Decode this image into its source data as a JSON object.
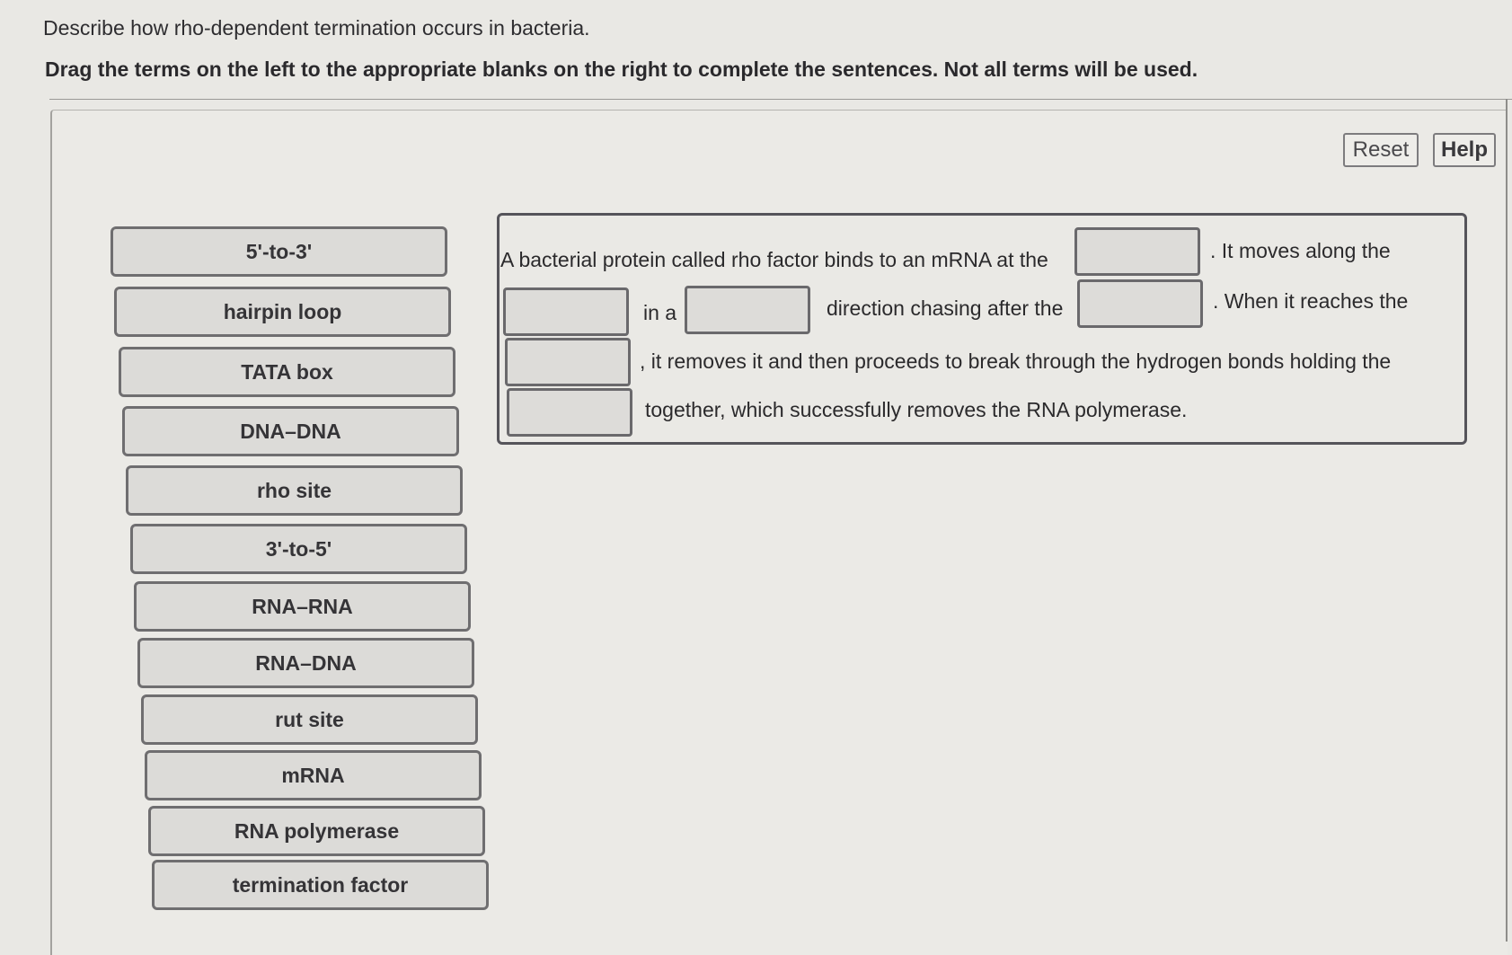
{
  "question": "Describe how rho-dependent termination occurs in bacteria.",
  "instructions": "Drag the terms on the left to the appropriate blanks on the right to complete the sentences. Not all terms will be used.",
  "toolbar": {
    "reset_label": "Reset",
    "help_label": "Help"
  },
  "terms": [
    "5'-to-3'",
    "hairpin loop",
    "TATA box",
    "DNA–DNA",
    "rho site",
    "3'-to-5'",
    "RNA–RNA",
    "RNA–DNA",
    "rut site",
    "mRNA",
    "RNA polymerase",
    "termination factor"
  ],
  "sentence": {
    "segments": [
      "A bacterial protein called rho factor binds to an mRNA at the",
      ". It moves along the",
      "in a",
      "direction chasing after the",
      ". When it reaches the",
      ", it removes it and then proceeds to break through the hydrogen bonds holding the",
      "together, which successfully removes the RNA polymerase."
    ],
    "blanks": [
      "",
      "",
      "",
      "",
      "",
      ""
    ]
  }
}
